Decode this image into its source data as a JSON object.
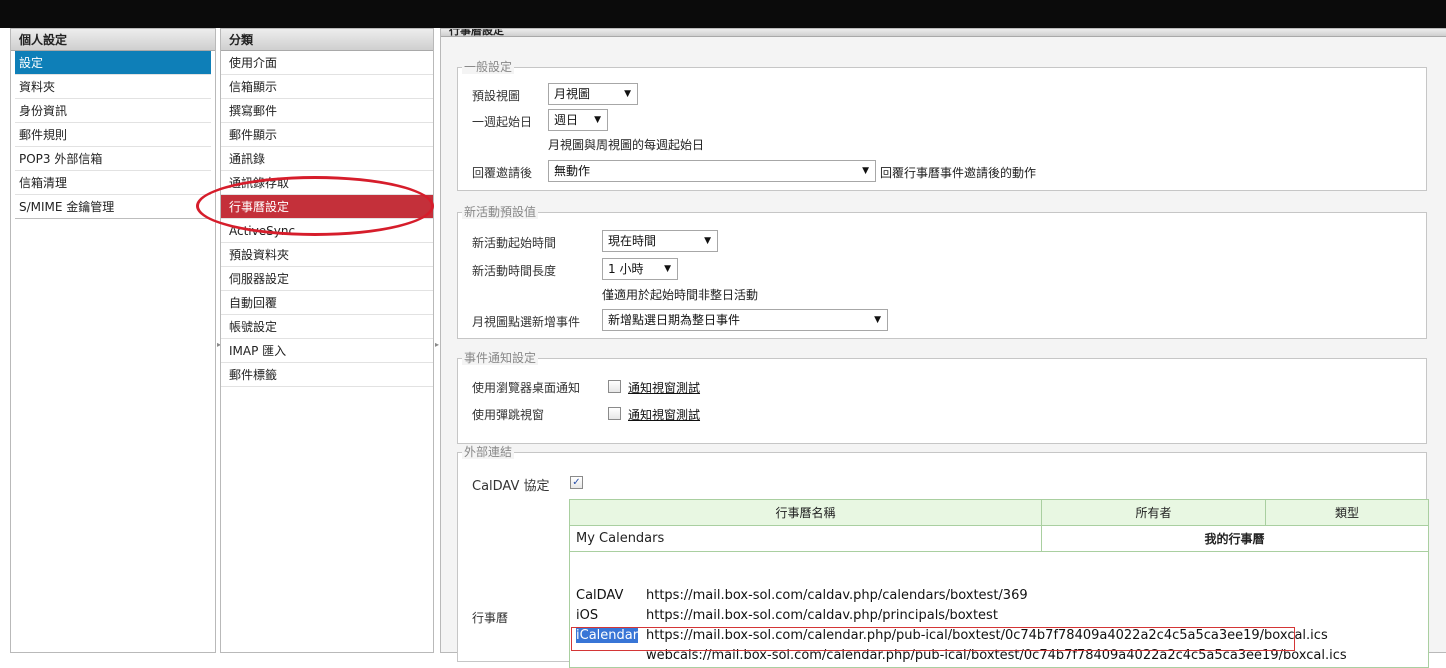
{
  "col1": {
    "header": "個人設定",
    "items": [
      "設定",
      "資料夾",
      "身份資訊",
      "郵件規則",
      "POP3 外部信箱",
      "信箱清理",
      "S/MIME 金鑰管理"
    ]
  },
  "col2": {
    "header": "分類",
    "items": [
      "使用介面",
      "信箱顯示",
      "撰寫郵件",
      "郵件顯示",
      "通訊錄",
      "通訊錄存取",
      "行事曆設定",
      "ActiveSync",
      "預設資料夾",
      "伺服器設定",
      "自動回覆",
      "帳號設定",
      "IMAP 匯入",
      "郵件標籤"
    ]
  },
  "col3": {
    "header": "行事曆設定"
  },
  "general": {
    "legend": "一般設定",
    "default_view_label": "預設視圖",
    "default_view_value": "月視圖",
    "week_start_label": "一週起始日",
    "week_start_value": "週日",
    "week_start_hint": "月視圖與周視圖的每週起始日",
    "reply_label": "回覆邀請後",
    "reply_value": "無動作",
    "reply_hint": "回覆行事曆事件邀請後的動作"
  },
  "new_event": {
    "legend": "新活動預設值",
    "start_label": "新活動起始時間",
    "start_value": "現在時間",
    "duration_label": "新活動時間長度",
    "duration_value": "1 小時",
    "duration_hint": "僅適用於起始時間非整日活動",
    "month_click_label": "月視圖點選新增事件",
    "month_click_value": "新增點選日期為整日事件"
  },
  "notify": {
    "legend": "事件通知設定",
    "browser_label": "使用瀏覽器桌面通知",
    "browser_test": "通知視窗測試",
    "popup_label": "使用彈跳視窗",
    "popup_test": "通知視窗測試"
  },
  "external": {
    "legend": "外部連結",
    "caldav_label": "CalDAV 協定",
    "calendar_label": "行事曆",
    "table": {
      "headers": [
        "行事曆名稱",
        "所有者",
        "類型"
      ],
      "row_name": "My Calendars",
      "row_type": "我的行事曆"
    },
    "links": [
      {
        "key": "CalDAV",
        "url": "https://mail.box-sol.com/caldav.php/calendars/boxtest/369"
      },
      {
        "key": "iOS",
        "url": "https://mail.box-sol.com/caldav.php/principals/boxtest"
      },
      {
        "key": "iCalendar",
        "url": "https://mail.box-sol.com/calendar.php/pub-ical/boxtest/0c74b7f78409a4022a2c4c5a5ca3ee19/boxcal.ics"
      },
      {
        "key": "",
        "url": "webcals://mail.box-sol.com/calendar.php/pub-ical/boxtest/0c74b7f78409a4022a2c4c5a5ca3ee19/boxcal.ics"
      }
    ]
  },
  "colors": {
    "selected_blue": "#0e7fb8",
    "selected_red": "#c4303a",
    "annotation_red": "#d61d2b",
    "table_header_green": "#e8f7e2"
  }
}
